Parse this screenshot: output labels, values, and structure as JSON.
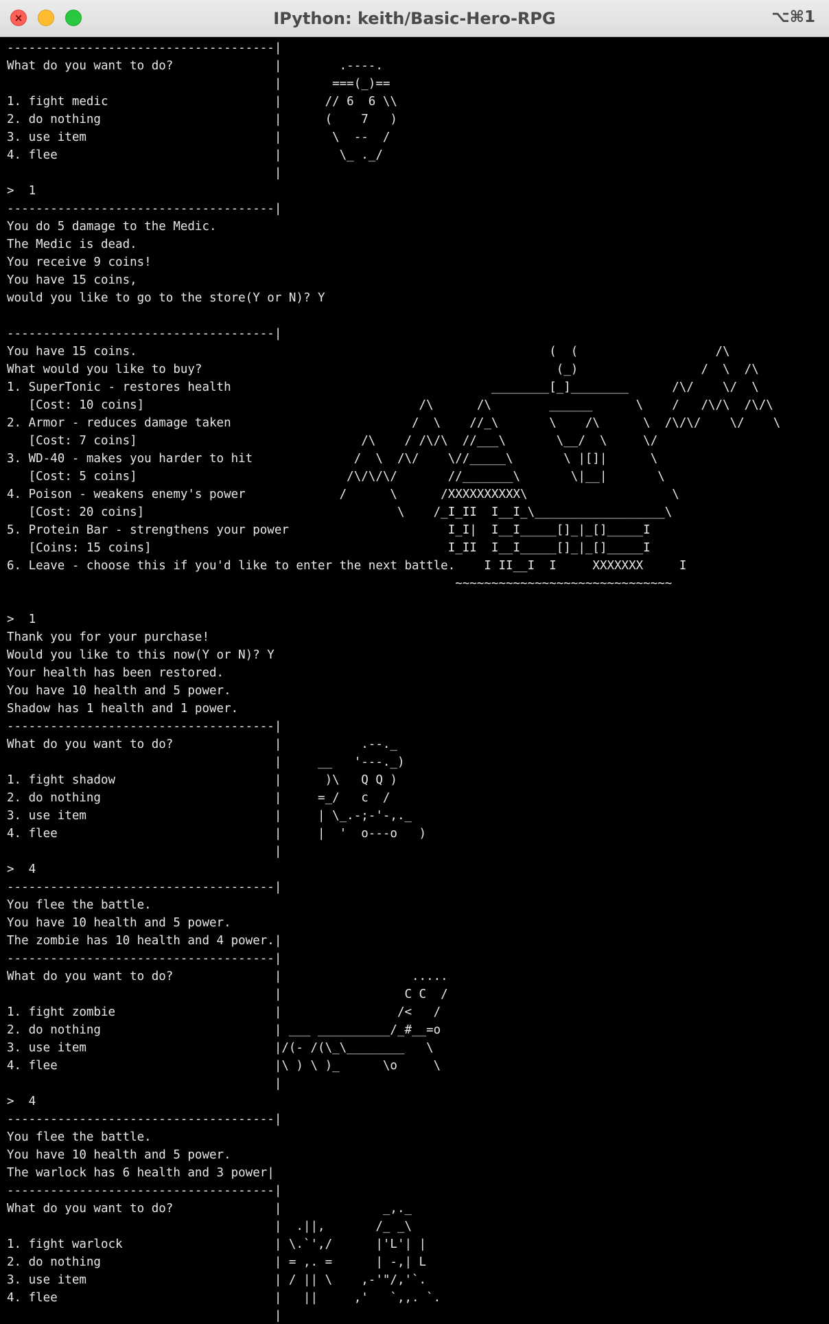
{
  "window": {
    "title": "IPython: keith/Basic-Hero-RPG",
    "shortcut": "⌥⌘1"
  },
  "terminal": {
    "lines": [
      "-------------------------------------|",
      "What do you want to do?              |        .----.",
      "                                     |       ===(_)==",
      "1. fight medic                       |      // 6  6 \\\\",
      "2. do nothing                        |      (    7   )",
      "3. use item                          |       \\  --  /",
      "4. flee                              |        \\_ ._/",
      "                                     |",
      ">  1",
      "-------------------------------------|",
      "You do 5 damage to the Medic.",
      "The Medic is dead.",
      "You receive 9 coins!",
      "You have 15 coins,",
      "would you like to go to the store(Y or N)? Y",
      "",
      "-------------------------------------|",
      "You have 15 coins.                                                         (  (                   /\\",
      "What would you like to buy?                                                 (_)                 /  \\  /\\",
      "1. SuperTonic - restores health                                    ________[_]________      /\\/    \\/  \\",
      "   [Cost: 10 coins]                                      /\\      /\\        ______      \\    /   /\\/\\  /\\/\\",
      "2. Armor - reduces damage taken                         /  \\    //_\\       \\    /\\      \\  /\\/\\/    \\/    \\",
      "   [Cost: 7 coins]                               /\\    / /\\/\\  //___\\       \\__/  \\     \\/",
      "3. WD-40 - makes you harder to hit              /  \\  /\\/    \\//_____\\       \\ |[]|      \\",
      "   [Cost: 5 coins]                             /\\/\\/\\/       //_______\\       \\|__|       \\",
      "4. Poison - weakens enemy's power             /      \\      /XXXXXXXXXX\\                    \\",
      "   [Cost: 20 coins]                                   \\    /_I_II  I__I_\\__________________\\",
      "5. Protein Bar - strengthens your power                      I_I|  I__I_____[]_|_[]_____I",
      "   [Coins: 15 coins]                                         I_II  I__I_____[]_|_[]_____I",
      "6. Leave - choose this if you'd like to enter the next battle.    I II__I  I     XXXXXXX     I",
      "                                                              ~~~~~~~~~~~~~~~~~~~~~~~~~~~~~~",
      "",
      ">  1",
      "Thank you for your purchase!",
      "Would you like to this now(Y or N)? Y",
      "Your health has been restored.",
      "You have 10 health and 5 power.",
      "Shadow has 1 health and 1 power.",
      "-------------------------------------|",
      "What do you want to do?              |           .--._",
      "                                     |     __   '---._)",
      "1. fight shadow                      |      )\\   Q Q )",
      "2. do nothing                        |     =_/   c  /",
      "3. use item                          |     | \\_.-;-'-,._",
      "4. flee                              |     |  '  o---o   )",
      "                                     |",
      ">  4",
      "-------------------------------------|",
      "You flee the battle.",
      "You have 10 health and 5 power.",
      "The zombie has 10 health and 4 power.|",
      "-------------------------------------|",
      "What do you want to do?              |                  .....",
      "                                     |                 C C  /",
      "1. fight zombie                      |                /<   /",
      "2. do nothing                        | ___ __________/_#__=o",
      "3. use item                          |/(- /(\\_\\________   \\",
      "4. flee                              |\\ ) \\ )_      \\o     \\",
      "                                     |",
      ">  4",
      "-------------------------------------|",
      "You flee the battle.",
      "You have 10 health and 5 power.",
      "The warlock has 6 health and 3 power|",
      "-------------------------------------|",
      "What do you want to do?              |              _,._",
      "                                     |  .||,       /_ _\\",
      "1. fight warlock                     | \\.`',/      |'L'| |",
      "2. do nothing                        | = ,. =      | -,| L",
      "3. use item                          | / || \\    ,-'\"/,'`.",
      "4. flee                              |   ||     ,'   `,,. `.",
      "                                     |"
    ]
  }
}
